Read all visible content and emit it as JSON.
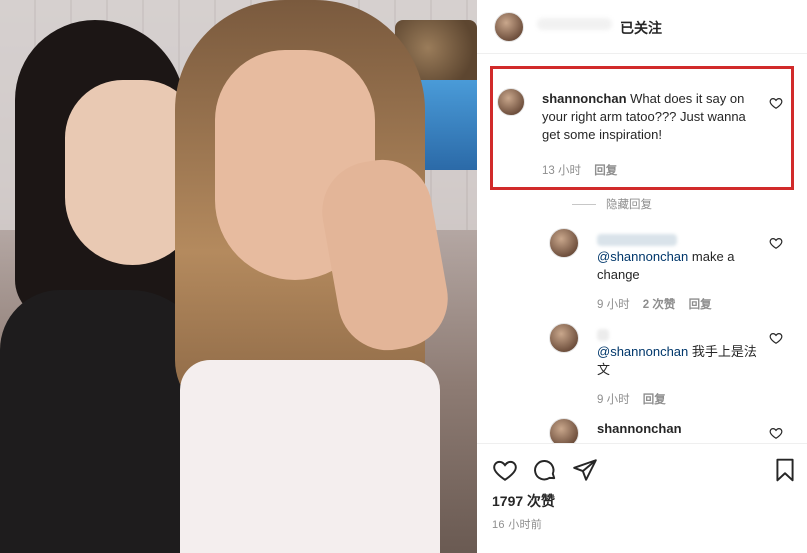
{
  "header": {
    "follow_label": "已关注",
    "avatar_icon": "user-avatar"
  },
  "main_comment": {
    "username": "shannonchan",
    "text": "What does it say on your right arm tatoo??? Just wanna get some inspiration!",
    "time": "13 小时",
    "reply_label": "回复"
  },
  "hidden_replies_label": "隐藏回复",
  "replies": [
    {
      "mention": "@shannonchan",
      "text": "make a change",
      "time": "9 小时",
      "likes": "2 次赞",
      "reply_label": "回复"
    },
    {
      "mention": "@shannonchan",
      "text": "我手上是法文",
      "time": "9 小时",
      "reply_label": "回复"
    },
    {
      "username": "shannonchan"
    }
  ],
  "footer": {
    "likes": "1797 次赞",
    "time": "16 小时前",
    "icons": [
      "heart-icon",
      "comment-icon",
      "share-icon",
      "bookmark-icon"
    ]
  },
  "colors": {
    "highlight_border": "#d12a2a",
    "mention": "#00376b",
    "meta_gray": "#8e8e8e"
  }
}
